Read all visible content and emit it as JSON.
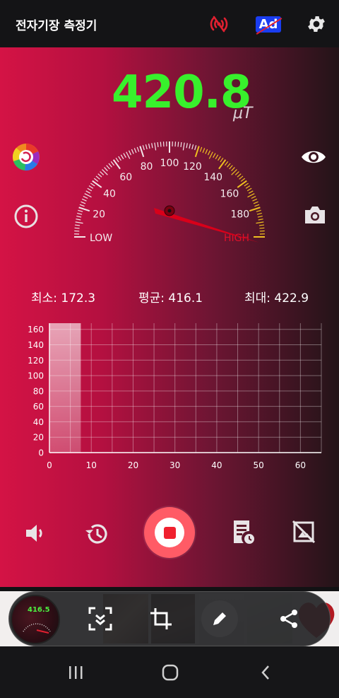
{
  "app": {
    "title": "전자기장 측정기",
    "icons": [
      "no-signal-icon",
      "ad-off-icon",
      "gear-icon"
    ],
    "ad_badge_label": "Ad"
  },
  "reading": {
    "value": "420.8",
    "unit": "μT",
    "value_color": "#38f02c"
  },
  "side_icons": {
    "left": [
      "color-theme-icon",
      "info-icon"
    ],
    "right": [
      "eye-icon",
      "camera-icon"
    ]
  },
  "gauge": {
    "tick_labels": [
      "LOW",
      "20",
      "40",
      "60",
      "80",
      "100",
      "120",
      "140",
      "160",
      "180",
      "HIGH"
    ],
    "min": 0,
    "max": 200,
    "needle_value": 200,
    "warning_from": 120,
    "warning_color": "#f0c020",
    "needle_color": "#d8001a"
  },
  "stats": {
    "min_label": "최소: 172.3",
    "avg_label": "평균: 416.1",
    "max_label": "최대: 422.9"
  },
  "chart_data": {
    "type": "area",
    "x_ticks": [
      "0",
      "10",
      "20",
      "30",
      "40",
      "50",
      "60"
    ],
    "y_ticks": [
      "0",
      "20",
      "40",
      "60",
      "80",
      "100",
      "120",
      "140",
      "160"
    ],
    "xlim": [
      0,
      65
    ],
    "ylim": [
      0,
      168
    ],
    "series": [
      {
        "x": [
          0,
          7.5
        ],
        "y": [
          168,
          168
        ]
      }
    ],
    "grid": true
  },
  "controls": {
    "icons": [
      "volume-icon",
      "history-icon",
      "record-stop-icon",
      "log-icon",
      "no-screenshot-icon"
    ]
  },
  "screenshot_toolbar": {
    "thumb_value": "416.5",
    "icons": [
      "scroll-capture-icon",
      "crop-icon",
      "draw-icon",
      "share-icon"
    ]
  },
  "navbar": {
    "icons": [
      "recents-icon",
      "home-icon",
      "back-icon"
    ]
  }
}
